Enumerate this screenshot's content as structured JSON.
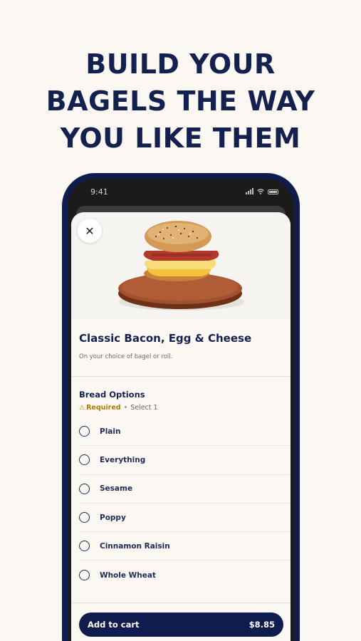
{
  "headline": {
    "line1": "BUILD YOUR",
    "line2": "BAGELS THE WAY",
    "line3": "YOU LIKE THEM"
  },
  "status_bar": {
    "time": "9:41"
  },
  "item": {
    "title": "Classic Bacon, Egg & Cheese",
    "description": "On your choice of bagel or roll."
  },
  "bread_options": {
    "title": "Bread Options",
    "required_label": "Required",
    "separator": "•",
    "select_hint": "Select 1",
    "options": [
      {
        "label": "Plain"
      },
      {
        "label": "Everything"
      },
      {
        "label": "Sesame"
      },
      {
        "label": "Poppy"
      },
      {
        "label": "Cinnamon Raisin"
      },
      {
        "label": "Whole Wheat"
      }
    ]
  },
  "cart": {
    "label": "Add to cart",
    "price": "$8.85"
  },
  "colors": {
    "navy": "#0f1c4d",
    "background": "#fbf7f2",
    "warning": "#b57a06"
  }
}
